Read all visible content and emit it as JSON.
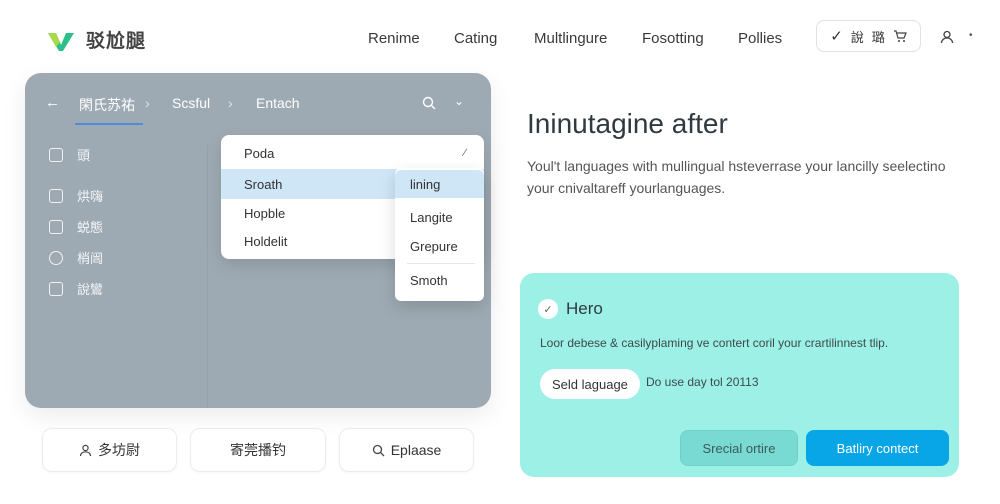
{
  "brand": {
    "name": "驳尬腿",
    "accent": "#2bbf8a"
  },
  "nav": [
    "Renime",
    "Cating",
    "Multlingure",
    "Fosotting",
    "Pollies"
  ],
  "top_actions": {
    "check": "✓",
    "label1": "說",
    "label2": "璐",
    "cart": "🛒"
  },
  "user": {
    "icon": "user-icon",
    "caret": "•"
  },
  "panel": {
    "crumbs": [
      "閑氏苏祐",
      "Scsful",
      "Entach"
    ],
    "side_items": [
      "頭",
      "烘嗨",
      "蜕態",
      "梢闿",
      "說鸞"
    ],
    "dropdown": [
      "Poda",
      "Sroath",
      "Hopble",
      "Holdelit"
    ],
    "dropdown_mark": "⁄",
    "submenu": [
      "lining",
      "Langite",
      "Grepure",
      "Smoth"
    ]
  },
  "bottom_buttons": [
    "多坊尉",
    "寄莞播钓",
    "Eplaase"
  ],
  "hero": {
    "title": "Ininutagine after",
    "lead": "Youl't languages with mullingual hsteverrase your lancilly seelectino your cnivaltareff yourlanguages."
  },
  "card": {
    "title": "Hero",
    "desc": "Loor debese & casilyplaming ve contert coril your crartilinnest tlip.",
    "pill": "Seld laguage",
    "note": "Do use day tol 20113",
    "secondary": "Srecial ortire",
    "primary": "Batliry contect",
    "bg": "#9df0e6",
    "primary_color": "#08a6e6"
  }
}
